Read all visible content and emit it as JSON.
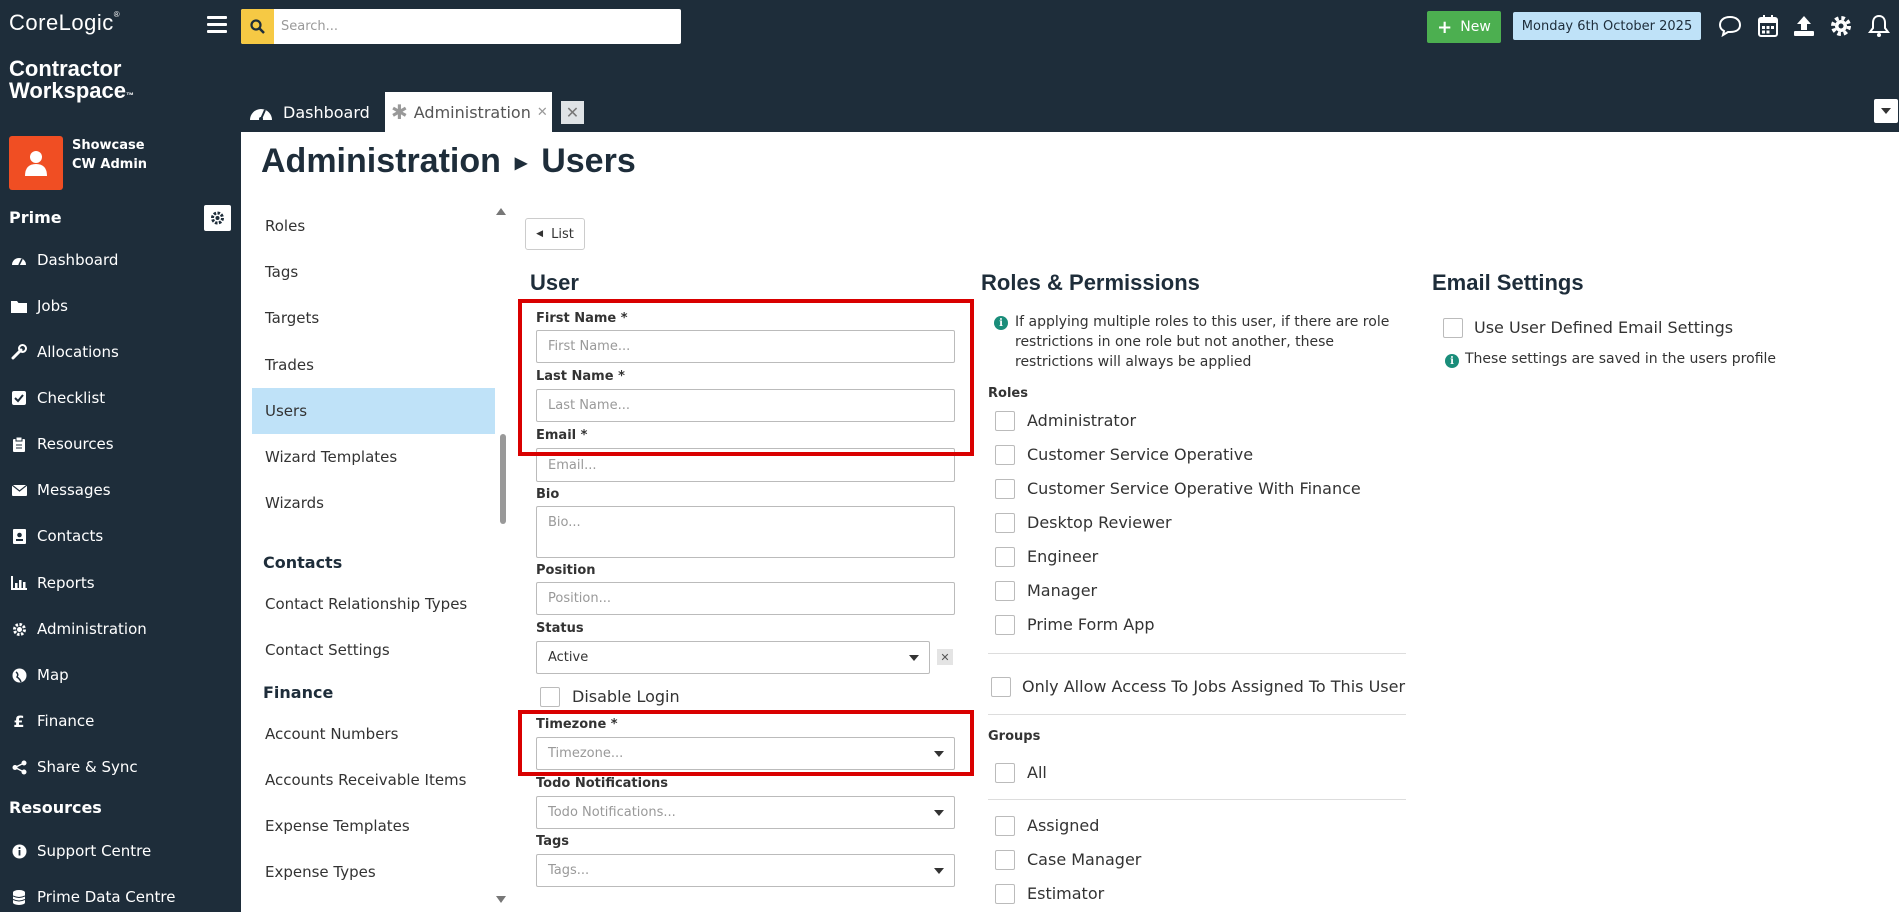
{
  "brand": {
    "logo": "CoreLogic",
    "logo_mark": "®",
    "app_line1": "Contractor",
    "app_line2": "Workspace",
    "app_mark": "™"
  },
  "user": {
    "line1": "Showcase",
    "line2": "CW Admin"
  },
  "sidebar": {
    "section_prime": "Prime",
    "items": [
      {
        "label": "Dashboard",
        "icon": "dashboard-icon"
      },
      {
        "label": "Jobs",
        "icon": "folder-icon"
      },
      {
        "label": "Allocations",
        "icon": "wrench-icon"
      },
      {
        "label": "Checklist",
        "icon": "checkbox-icon"
      },
      {
        "label": "Resources",
        "icon": "clipboard-icon"
      },
      {
        "label": "Messages",
        "icon": "envelope-icon"
      },
      {
        "label": "Contacts",
        "icon": "contact-card-icon"
      },
      {
        "label": "Reports",
        "icon": "bar-chart-icon"
      },
      {
        "label": "Administration",
        "icon": "gear-icon"
      },
      {
        "label": "Map",
        "icon": "globe-icon"
      },
      {
        "label": "Finance",
        "icon": "pound-icon"
      },
      {
        "label": "Share & Sync",
        "icon": "share-icon"
      }
    ],
    "section_resources": "Resources",
    "resource_items": [
      {
        "label": "Support Centre",
        "icon": "info-icon"
      },
      {
        "label": "Prime Data Centre",
        "icon": "database-icon"
      }
    ]
  },
  "topbar": {
    "search_placeholder": "Search...",
    "new_label": "New",
    "date": "Monday 6th October 2025"
  },
  "tabs": [
    {
      "label": "Dashboard"
    },
    {
      "label": "Administration"
    }
  ],
  "page": {
    "title_main": "Administration",
    "title_sub": "Users"
  },
  "admin_nav": {
    "items_top": [
      "Roles",
      "Tags",
      "Targets",
      "Trades",
      "Users",
      "Wizard Templates",
      "Wizards"
    ],
    "group_contacts": "Contacts",
    "contacts_items": [
      "Contact Relationship Types",
      "Contact Settings"
    ],
    "group_finance": "Finance",
    "finance_items": [
      "Account Numbers",
      "Accounts Receivable Items",
      "Expense Templates",
      "Expense Types"
    ]
  },
  "list_button": "List",
  "user_form": {
    "title": "User",
    "first_name_label": "First Name *",
    "first_name_placeholder": "First Name...",
    "last_name_label": "Last Name *",
    "last_name_placeholder": "Last Name...",
    "email_label": "Email *",
    "email_placeholder": "Email...",
    "bio_label": "Bio",
    "bio_placeholder": "Bio...",
    "position_label": "Position",
    "position_placeholder": "Position...",
    "status_label": "Status",
    "status_value": "Active",
    "disable_login_label": "Disable Login",
    "timezone_label": "Timezone *",
    "timezone_placeholder": "Timezone...",
    "todo_label": "Todo Notifications",
    "todo_placeholder": "Todo Notifications...",
    "tags_label": "Tags",
    "tags_placeholder": "Tags..."
  },
  "roles_perms": {
    "title": "Roles & Permissions",
    "info": "If applying multiple roles to this user, if there are role restrictions in one role but not another, these restrictions will always be applied",
    "roles_label": "Roles",
    "roles": [
      "Administrator",
      "Customer Service Operative",
      "Customer Service Operative With Finance",
      "Desktop Reviewer",
      "Engineer",
      "Manager",
      "Prime Form App"
    ],
    "only_assigned_label": "Only Allow Access To Jobs Assigned To This User",
    "groups_label": "Groups",
    "group_all": "All",
    "groups": [
      "Assigned",
      "Case Manager",
      "Estimator"
    ]
  },
  "email_settings": {
    "title": "Email Settings",
    "use_user_defined_label": "Use User Defined Email Settings",
    "info": "These settings are saved in the users profile"
  },
  "colors": {
    "sidebar": "#1e2d3a",
    "accent_orange": "#f04e23",
    "highlight_blue": "#bfe2f8",
    "new_green": "#4caf50",
    "search_yellow": "#f6c944",
    "annotation_red": "#d90000"
  }
}
